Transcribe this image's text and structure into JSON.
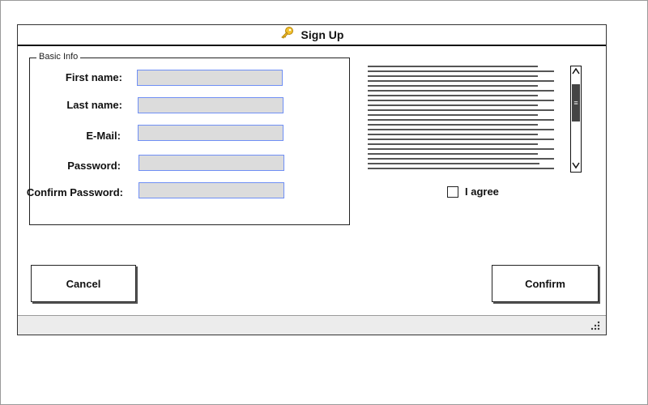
{
  "window": {
    "title": "Sign Up",
    "title_icon": "key-icon"
  },
  "basic_info": {
    "legend": "Basic Info",
    "fields": [
      {
        "label": "First name:",
        "value": ""
      },
      {
        "label": "Last name:",
        "value": ""
      },
      {
        "label": "E-Mail:",
        "value": ""
      },
      {
        "label": "Password:",
        "value": ""
      },
      {
        "label": "Confirm Password:",
        "value": ""
      }
    ]
  },
  "terms": {
    "agree_label": "I agree",
    "checked": false,
    "scroll_up_icon": "chevron-up-icon",
    "scroll_down_icon": "chevron-down-icon"
  },
  "buttons": {
    "cancel": "Cancel",
    "confirm": "Confirm"
  },
  "statusbar": {
    "grip_icon": "resize-grip-icon"
  }
}
